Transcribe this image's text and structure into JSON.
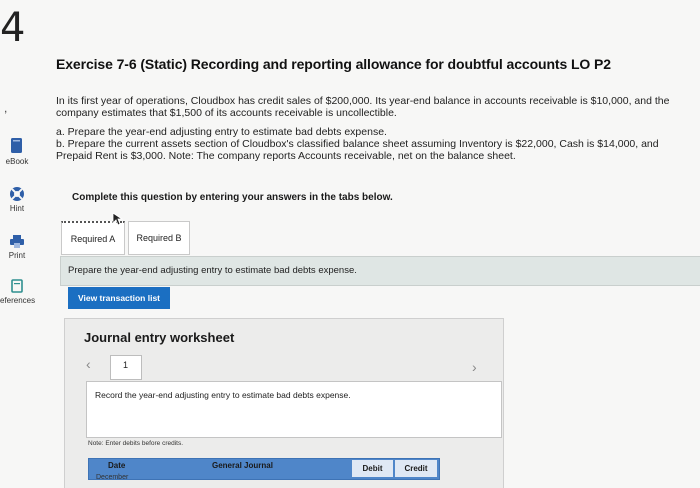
{
  "question_number": "4",
  "rail": {
    "dot": ",",
    "items": [
      {
        "label": "eBook",
        "icon": "book-icon"
      },
      {
        "label": "Hint",
        "icon": "hint-icon"
      },
      {
        "label": "Print",
        "icon": "print-icon"
      },
      {
        "label": "eferences",
        "icon": "references-icon"
      }
    ]
  },
  "exercise": {
    "title": "Exercise 7-6 (Static) Recording and reporting allowance for doubtful accounts LO P2",
    "paragraph": "In its first year of operations, Cloudbox has credit sales of $200,000. Its year-end balance in accounts receivable is $10,000, and the company estimates that $1,500 of its accounts receivable is uncollectible.",
    "task_a": "a. Prepare the year-end adjusting entry to estimate bad debts expense.",
    "task_b": "b. Prepare the current assets section of Cloudbox's classified balance sheet assuming Inventory is $22,000, Cash is $14,000, and Prepaid Rent is $3,000. Note: The company reports Accounts receivable, net on the balance sheet."
  },
  "complete_prompt": "Complete this question by entering your answers in the tabs below.",
  "tabs": [
    {
      "label": "Required A"
    },
    {
      "label": "Required B"
    }
  ],
  "instruction": "Prepare the year-end adjusting entry to estimate bad debts expense.",
  "view_button": "View transaction list",
  "worksheet": {
    "title": "Journal entry worksheet",
    "page": "1",
    "record_text": "Record the year-end adjusting entry to estimate bad debts expense.",
    "note": "Note: Enter debits before credits.",
    "columns": [
      "Date",
      "General Journal",
      "Debit",
      "Credit"
    ],
    "first_row_date": "December"
  },
  "colors": {
    "accent": "#1b6fc2",
    "table_header": "#4f86c9",
    "instruction_bar": "#dfe6e4"
  }
}
